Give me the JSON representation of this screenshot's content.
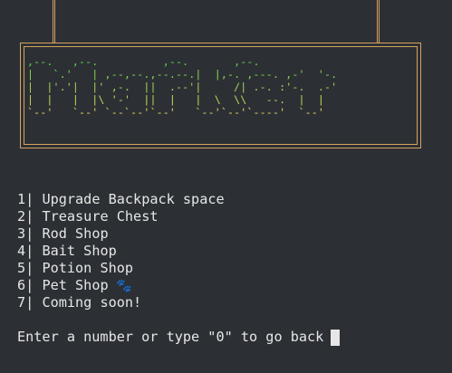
{
  "sign": {
    "title": "Market",
    "art_lines": [
      ",--.   ,--.          ,--.       ,--.",
      "|   `.'   | ,--,--.,--.--.|  |,-. ,---. ,-'  '-.",
      "|  |'.'|  |' ,-.  ||  .--'|     /| .-. :'-.  .-'",
      "|  |   |  |\\ '-'  ||  |   |  \\  \\\\   --.  |  |",
      "`--'   `--' `--`--'`--'   `--'`--'`----'  `--'"
    ],
    "colors": {
      "top": "#66d34c",
      "bottom": "#e5d45b",
      "frame": "#d6a25c"
    }
  },
  "menu": [
    {
      "number": "1",
      "sep": "|",
      "label": "Upgrade Backpack space"
    },
    {
      "number": "2",
      "sep": "|",
      "label": "Treasure Chest"
    },
    {
      "number": "3",
      "sep": "|",
      "label": "Rod Shop"
    },
    {
      "number": "4",
      "sep": "|",
      "label": "Bait Shop"
    },
    {
      "number": "5",
      "sep": "|",
      "label": "Potion Shop"
    },
    {
      "number": "6",
      "sep": "|",
      "label": "Pet Shop",
      "icon": "paw-icon"
    },
    {
      "number": "7",
      "sep": "|",
      "label": "Coming soon!"
    }
  ],
  "prompt": {
    "text": "Enter a number or type \"0\" to go back"
  },
  "theme": {
    "background": "#2c3035",
    "text": "#e6e6e6",
    "paw": "#5aa6ff"
  }
}
